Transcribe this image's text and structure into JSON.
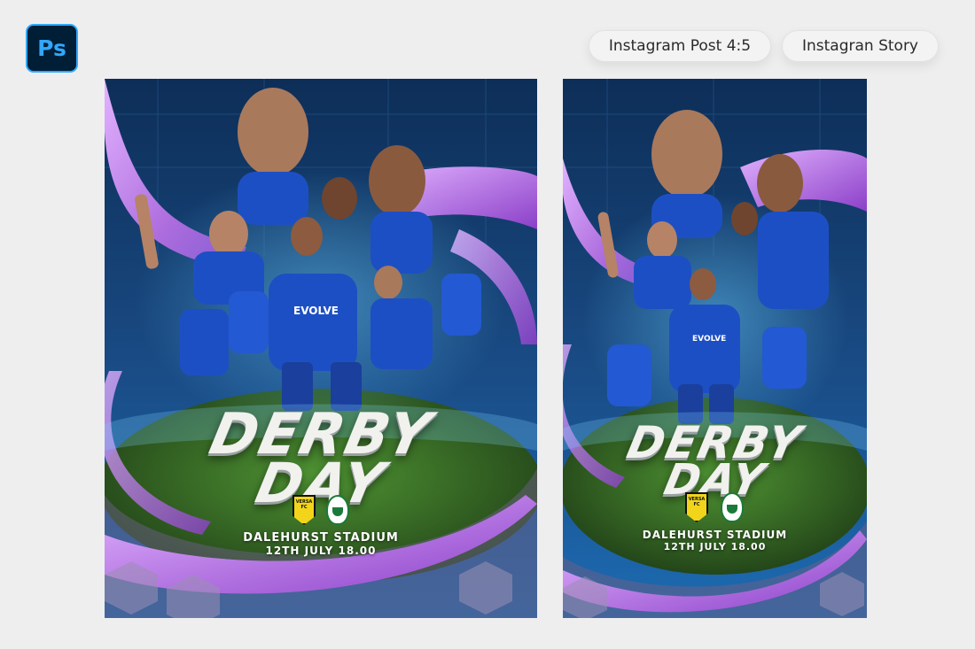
{
  "app": {
    "icon_label": "Ps"
  },
  "formats": [
    {
      "label": "Instagram Post 4:5"
    },
    {
      "label": "Instagran Story"
    }
  ],
  "poster": {
    "title_line1": "DERBY",
    "title_line2": "DAY",
    "venue": "DALEHURST STADIUM",
    "date_time": "12TH JULY   18.00",
    "sponsor": "EVOLVE",
    "home_crest_text": "VERSA FC"
  },
  "colors": {
    "accent_purple": "#b46be0",
    "pitch_green": "#3f7d2a",
    "kit_blue": "#1d4fc4",
    "ps_brand": "#31a8ff"
  }
}
